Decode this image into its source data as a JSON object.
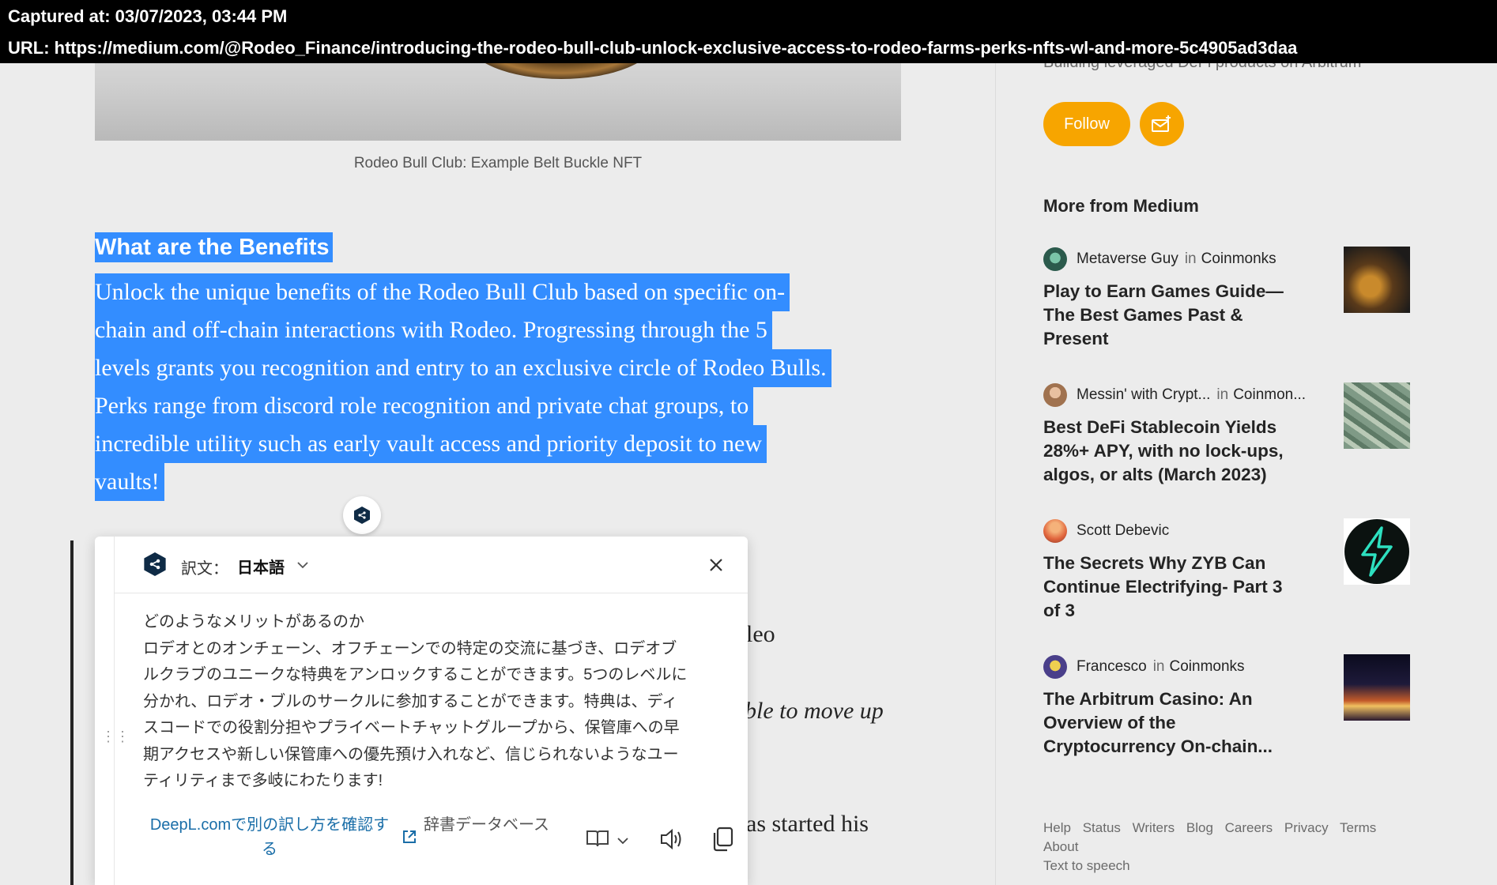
{
  "capture": {
    "captured_at": "Captured at: 03/07/2023, 03:44 PM",
    "url": "URL: https://medium.com/@Rodeo_Finance/introducing-the-rodeo-bull-club-unlock-exclusive-access-to-rodeo-farms-perks-nfts-wl-and-more-5c4905ad3daa"
  },
  "article": {
    "image_caption": "Rodeo Bull Club: Example Belt Buckle NFT",
    "benefits_heading": "What are the Benefits",
    "benefits_lines": [
      "Unlock the unique benefits of the Rodeo Bull Club based on specific on-",
      "chain and off-chain interactions with Rodeo. Progressing through the 5",
      "levels grants you recognition and entry to an exclusive circle of Rodeo Bulls.",
      "Perks range from discord role recognition and private chat groups, to",
      "incredible utility such as early vault access and priority deposit to new",
      "vaults!"
    ],
    "partial_behind": {
      "frag1": "leo",
      "frag2": "ble to move up",
      "frag3": "as started his"
    }
  },
  "deepl": {
    "target_label": "訳文：",
    "language": "日本語",
    "translation_lines": [
      "どのようなメリットがあるのか",
      "ロデオとのオンチェーン、オフチェーンでの特定の交流に基づき、ロデオブ",
      "ルクラブのユニークな特典をアンロックすることができます。5つのレベルに",
      "分かれ、ロデオ・ブルのサークルに参加することができます。特典は、ディ",
      "スコードでの役割分担やプライベートチャットグループから、保管庫への早",
      "期アクセスや新しい保管庫への優先預け入れなど、信じられないようなユー",
      "ティリティまで多岐にわたります!"
    ],
    "alt_translations_link": "DeepL.comで別の訳し方を確認する",
    "dictionary_label": "辞書データベース"
  },
  "sidebar": {
    "author_desc": "Building leveraged DeFi products on Arbitrum",
    "follow_label": "Follow",
    "more_title": "More from Medium",
    "stories": [
      {
        "author": "Metaverse Guy",
        "in": "in",
        "publication": "Coinmonks",
        "title": "Play to Earn Games Guide— The Best Games Past & Present"
      },
      {
        "author": "Messin' with Crypt...",
        "in": "in",
        "publication": "Coinmon...",
        "title": "Best DeFi Stablecoin Yields 28%+ APY, with no lock-ups, algos, or alts (March 2023)"
      },
      {
        "author": "Scott Debevic",
        "in": "",
        "publication": "",
        "title": "The Secrets Why ZYB Can Continue Electrifying- Part 3 of 3"
      },
      {
        "author": "Francesco",
        "in": "in",
        "publication": "Coinmonks",
        "title": "The Arbitrum Casino: An Overview of the Cryptocurrency On-chain..."
      }
    ],
    "footer_links": [
      "Help",
      "Status",
      "Writers",
      "Blog",
      "Careers",
      "Privacy",
      "Terms",
      "About",
      "Text to speech"
    ]
  },
  "colors": {
    "selection": "#338dff",
    "accent_orange": "#f7a500",
    "deepl_navy": "#0f2b46",
    "link_blue": "#1a6ea8"
  }
}
